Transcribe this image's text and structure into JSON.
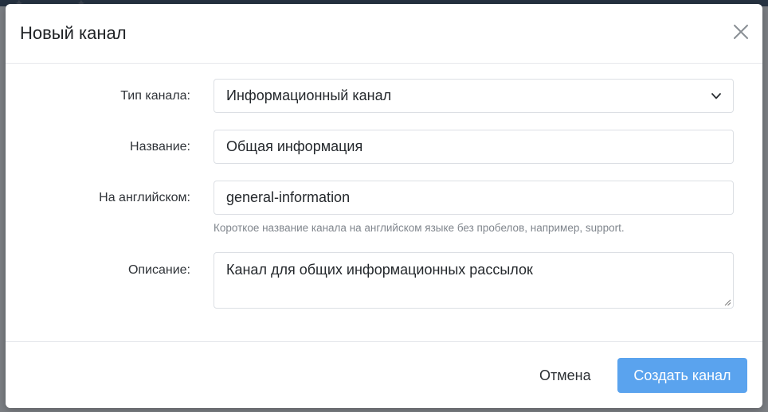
{
  "modal": {
    "title": "Новый канал"
  },
  "form": {
    "type": {
      "label": "Тип канала:",
      "value": "Информационный канал"
    },
    "name": {
      "label": "Название:",
      "value": "Общая информация"
    },
    "english": {
      "label": "На английском:",
      "value": "general-information",
      "hint": "Короткое название канала на английском языке без пробелов, например, support."
    },
    "description": {
      "label": "Описание:",
      "value": "Канал для общих информационных рассылок"
    }
  },
  "footer": {
    "cancel_label": "Отмена",
    "create_label": "Создать канал"
  },
  "colors": {
    "primary": "#5aa3ee",
    "backdrop": "#7b7e83"
  },
  "icons": {
    "close": "close-icon",
    "select": "chevron-down-icon",
    "resize": "resize-grip-icon"
  }
}
